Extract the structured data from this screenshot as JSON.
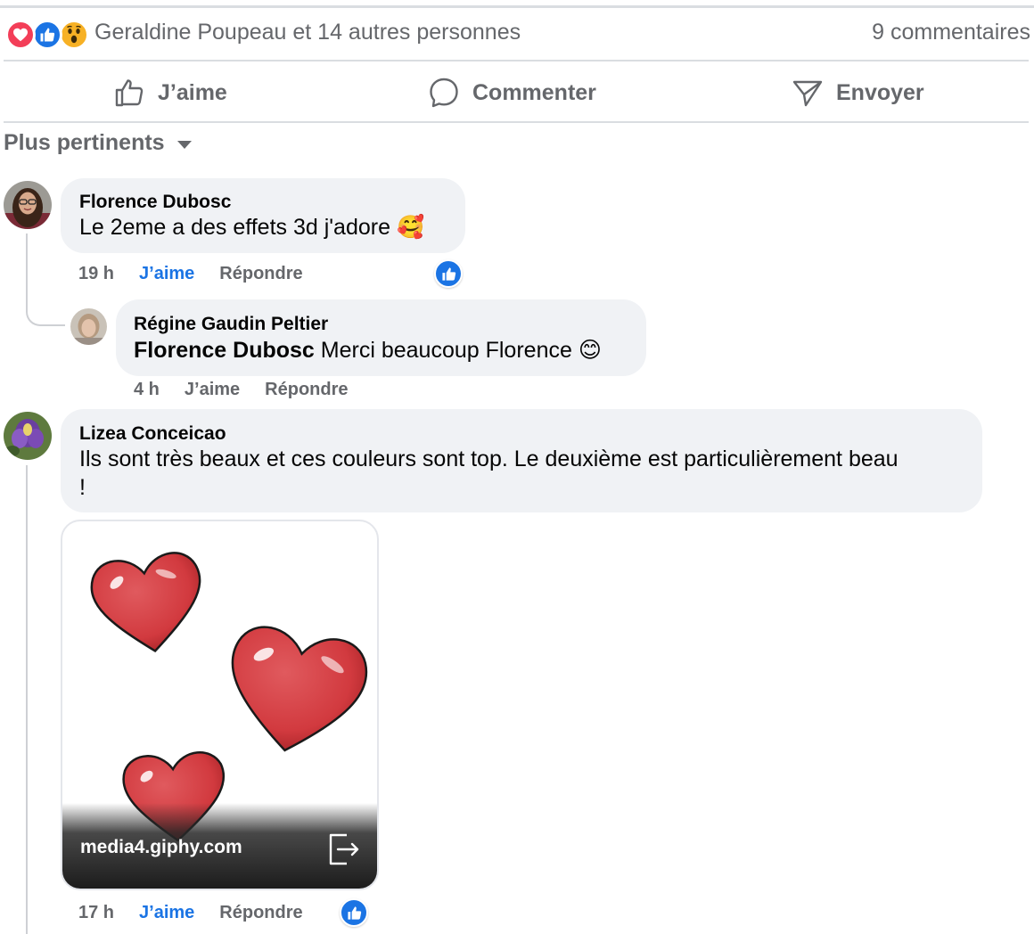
{
  "post_footer": {
    "reactions_summary": "Geraldine Poupeau et 14 autres personnes",
    "comments_count": "9 commentaires",
    "reaction_icons": [
      "love-icon",
      "like-icon",
      "wow-icon"
    ]
  },
  "actions": {
    "like": "J’aime",
    "comment": "Commenter",
    "send": "Envoyer"
  },
  "sort": {
    "label": "Plus pertinents"
  },
  "comments": [
    {
      "author": "Florence Dubosc",
      "text": "Le 2eme a des effets 3d j'adore",
      "emoji": "🥰",
      "time": "19 h",
      "like_label": "J’aime",
      "reply_label": "Répondre",
      "liked": true,
      "reply": {
        "author": "Régine Gaudin Peltier",
        "mention": "Florence Dubosc",
        "text": "Merci beaucoup Florence",
        "emoji": "😊",
        "time": "4 h",
        "like_label": "J’aime",
        "reply_label": "Répondre",
        "liked": false
      }
    },
    {
      "author": "Lizea Conceicao",
      "text_line1": "Ils sont très beaux et ces couleurs sont top. Le deuxième est particulièrement beau",
      "text_line2": "!",
      "gif_domain": "media4.giphy.com",
      "time": "17 h",
      "like_label": "J’aime",
      "reply_label": "Répondre",
      "liked": true
    }
  ],
  "colors": {
    "accent": "#1b74e4",
    "muted_text": "#65676b",
    "bubble": "#f0f2f5",
    "divider": "#dadde1",
    "heart_red": "#d93a3e"
  }
}
